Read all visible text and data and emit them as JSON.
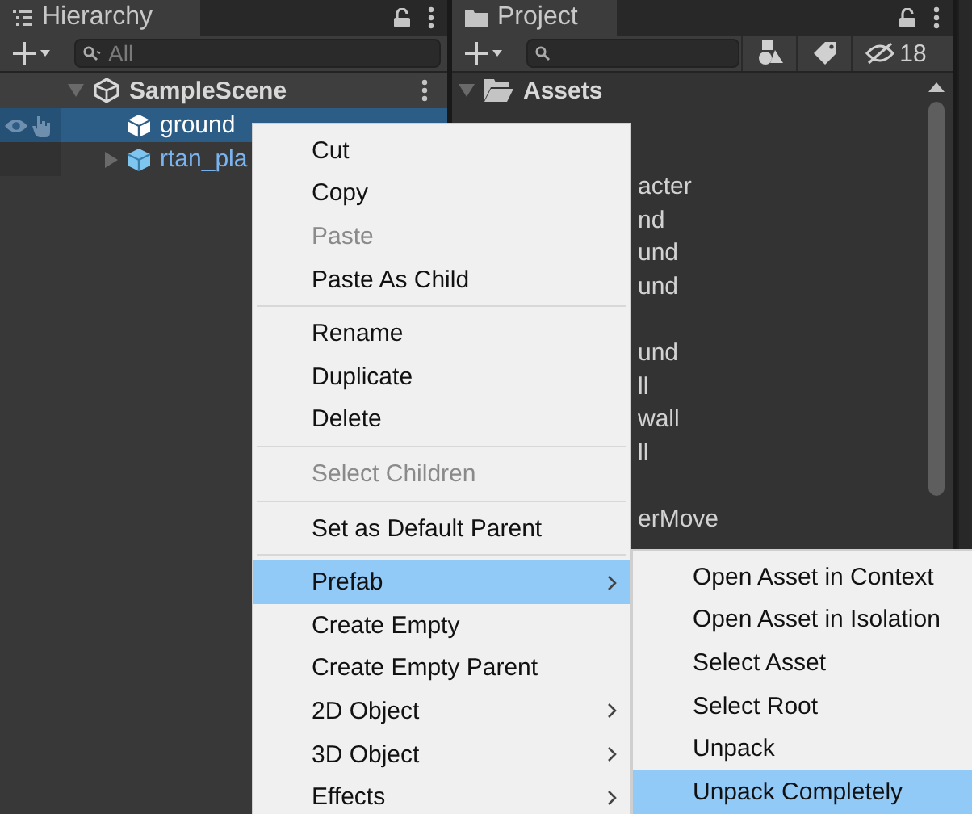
{
  "hierarchy": {
    "tab_title": "Hierarchy",
    "search_placeholder": "All",
    "scene": {
      "name": "SampleScene"
    },
    "items": [
      {
        "name": "ground",
        "selected": true,
        "expandable": false
      },
      {
        "name": "rtan_pla",
        "selected": false,
        "expandable": true
      }
    ]
  },
  "project": {
    "tab_title": "Project",
    "hidden_count": "18",
    "root": "Assets",
    "rows": [
      {
        "name": "acter"
      },
      {
        "name": "nd"
      },
      {
        "name": "und"
      },
      {
        "name": "und"
      },
      {
        "covered": true
      },
      {
        "name": "und"
      },
      {
        "name": "ll"
      },
      {
        "name": "wall"
      },
      {
        "name": "ll"
      },
      {
        "covered": true
      },
      {
        "name": "erMove"
      }
    ]
  },
  "context_menu": {
    "items": [
      {
        "kind": "item",
        "label": "Cut",
        "disabled": false,
        "submenu": false,
        "selected": false
      },
      {
        "kind": "item",
        "label": "Copy",
        "disabled": false,
        "submenu": false,
        "selected": false
      },
      {
        "kind": "item",
        "label": "Paste",
        "disabled": true,
        "submenu": false,
        "selected": false
      },
      {
        "kind": "item",
        "label": "Paste As Child",
        "disabled": false,
        "submenu": false,
        "selected": false
      },
      {
        "kind": "separator"
      },
      {
        "kind": "item",
        "label": "Rename",
        "disabled": false,
        "submenu": false,
        "selected": false
      },
      {
        "kind": "item",
        "label": "Duplicate",
        "disabled": false,
        "submenu": false,
        "selected": false
      },
      {
        "kind": "item",
        "label": "Delete",
        "disabled": false,
        "submenu": false,
        "selected": false
      },
      {
        "kind": "separator"
      },
      {
        "kind": "item",
        "label": "Select Children",
        "disabled": true,
        "submenu": false,
        "selected": false
      },
      {
        "kind": "separator"
      },
      {
        "kind": "item",
        "label": "Set as Default Parent",
        "disabled": false,
        "submenu": false,
        "selected": false
      },
      {
        "kind": "separator"
      },
      {
        "kind": "item",
        "label": "Prefab",
        "disabled": false,
        "submenu": true,
        "selected": true
      },
      {
        "kind": "item",
        "label": "Create Empty",
        "disabled": false,
        "submenu": false,
        "selected": false
      },
      {
        "kind": "item",
        "label": "Create Empty Parent",
        "disabled": false,
        "submenu": false,
        "selected": false
      },
      {
        "kind": "item",
        "label": "2D Object",
        "disabled": false,
        "submenu": true,
        "selected": false
      },
      {
        "kind": "item",
        "label": "3D Object",
        "disabled": false,
        "submenu": true,
        "selected": false
      },
      {
        "kind": "item",
        "label": "Effects",
        "disabled": false,
        "submenu": true,
        "selected": false
      }
    ]
  },
  "submenu": {
    "items": [
      {
        "label": "Open Asset in Context",
        "selected": false
      },
      {
        "label": "Open Asset in Isolation",
        "selected": false
      },
      {
        "label": "Select Asset",
        "selected": false
      },
      {
        "label": "Select Root",
        "selected": false
      },
      {
        "label": "Unpack",
        "selected": false
      },
      {
        "label": "Unpack Completely",
        "selected": true
      }
    ]
  }
}
